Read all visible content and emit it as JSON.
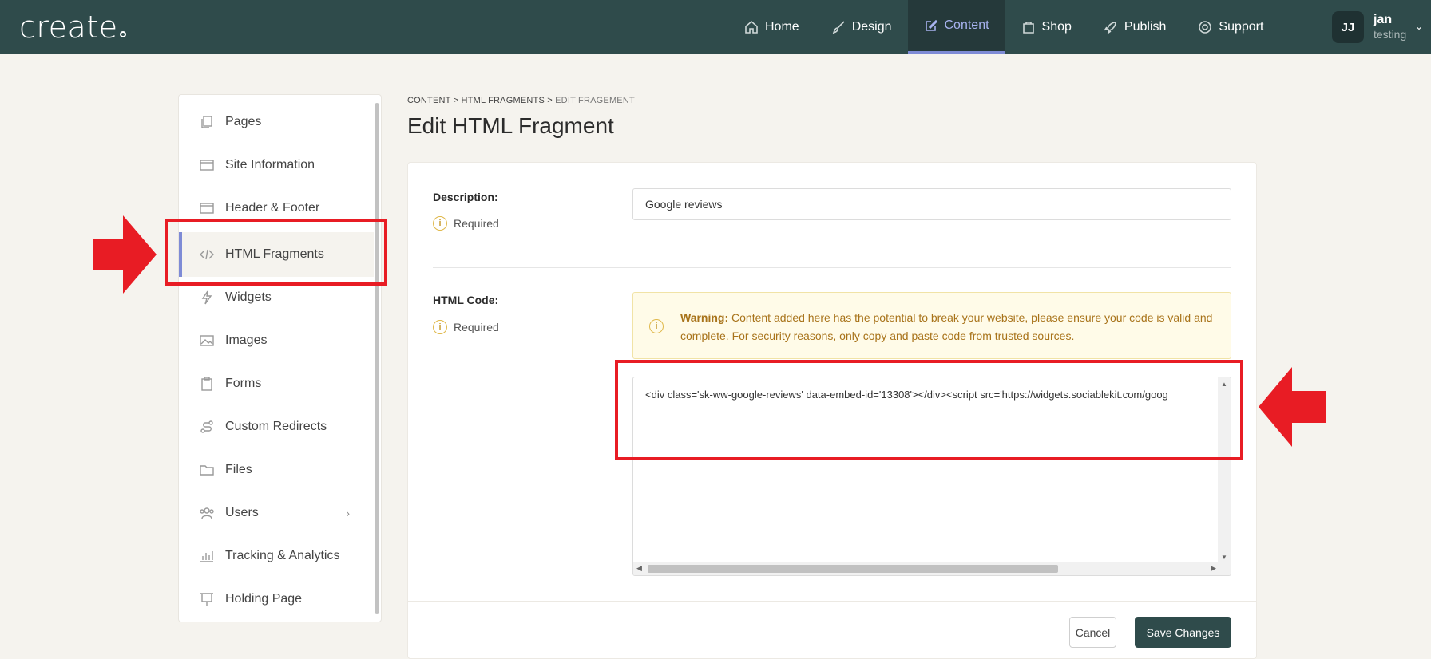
{
  "topbar": {
    "logo": "create",
    "nav": [
      {
        "label": "Home",
        "icon": "home-icon"
      },
      {
        "label": "Design",
        "icon": "brush-icon"
      },
      {
        "label": "Content",
        "icon": "edit-icon",
        "active": true
      },
      {
        "label": "Shop",
        "icon": "bag-icon"
      },
      {
        "label": "Publish",
        "icon": "rocket-icon"
      },
      {
        "label": "Support",
        "icon": "lifebuoy-icon"
      }
    ],
    "user": {
      "initials": "JJ",
      "name": "jan",
      "site": "testing"
    }
  },
  "sidebar": {
    "items": [
      {
        "label": "Pages",
        "icon": "pages-icon"
      },
      {
        "label": "Site Information",
        "icon": "window-icon"
      },
      {
        "label": "Header & Footer",
        "icon": "window-icon"
      },
      {
        "label": "HTML Fragments",
        "icon": "code-icon",
        "active": true
      },
      {
        "label": "Widgets",
        "icon": "lightning-icon"
      },
      {
        "label": "Images",
        "icon": "image-icon"
      },
      {
        "label": "Forms",
        "icon": "clipboard-icon"
      },
      {
        "label": "Custom Redirects",
        "icon": "route-icon"
      },
      {
        "label": "Files",
        "icon": "folder-icon"
      },
      {
        "label": "Users",
        "icon": "users-icon"
      },
      {
        "label": "Tracking & Analytics",
        "icon": "chart-icon"
      },
      {
        "label": "Holding Page",
        "icon": "easel-icon"
      }
    ]
  },
  "breadcrumb": {
    "items": [
      "CONTENT",
      "HTML FRAGMENTS",
      "EDIT FRAGEMENT"
    ],
    "separator": ">"
  },
  "page_title": "Edit HTML Fragment",
  "form": {
    "description": {
      "label": "Description:",
      "required": "Required",
      "value": "Google reviews"
    },
    "html_code": {
      "label": "HTML Code:",
      "required": "Required",
      "warning_title": "Warning:",
      "warning_body": "Content added here has the potential to break your website, please ensure your code is valid and complete. For security reasons, only copy and paste code from trusted sources.",
      "value": "<div class='sk-ww-google-reviews' data-embed-id='13308'></div><script src='https://widgets.sociablekit.com/goog"
    }
  },
  "actions": {
    "cancel": "Cancel",
    "save": "Save Changes"
  },
  "colors": {
    "topbar": "#2f4b4b",
    "accent": "#7e8bd6",
    "annotation": "#e81c24",
    "warning_text": "#a8731a"
  }
}
